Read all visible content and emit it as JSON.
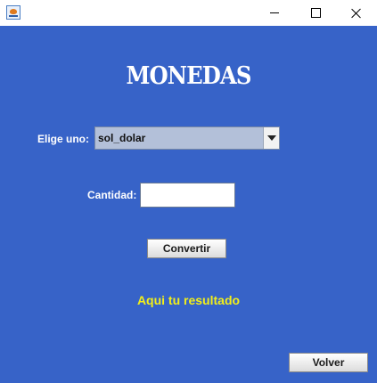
{
  "titlebar": {
    "icon": "java-cup-icon",
    "minimize_icon": "minimize-icon",
    "maximize_icon": "maximize-icon",
    "close_icon": "close-icon"
  },
  "main": {
    "title": "MONEDAS",
    "choose_label": "Elige uno:",
    "currency_select": {
      "selected": "sol_dolar"
    },
    "amount_label": "Cantidad:",
    "amount_value": "",
    "convert_button": "Convertir",
    "result_text": "Aqui tu resultado",
    "back_button": "Volver"
  },
  "colors": {
    "background": "#3763c8",
    "title_text": "#ffffff",
    "result_text": "#f2ef1a",
    "select_background": "#b3c0d9"
  }
}
